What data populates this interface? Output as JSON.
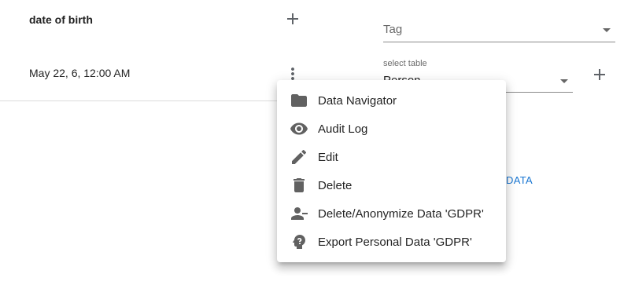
{
  "row1": {
    "field_name": "date of birth",
    "add_icon": "plus-icon"
  },
  "row2": {
    "field_value": "May 22, 6, 12:00 AM",
    "more_icon": "more-vert-icon"
  },
  "tag_select": {
    "value": "Tag"
  },
  "table_select": {
    "label": "select table",
    "value": "Person",
    "add_icon": "plus-icon"
  },
  "background_link": "DATA",
  "colors": {
    "accent": "#1976d2",
    "icon": "#616161"
  },
  "menu": {
    "items": [
      {
        "label": "Data Navigator",
        "icon": "folder-icon"
      },
      {
        "label": "Audit Log",
        "icon": "eye-icon"
      },
      {
        "label": "Edit",
        "icon": "pencil-icon"
      },
      {
        "label": "Delete",
        "icon": "trash-icon"
      },
      {
        "label": "Delete/Anonymize Data 'GDPR'",
        "icon": "person-remove-icon"
      },
      {
        "label": "Export Personal Data 'GDPR'",
        "icon": "head-question-icon"
      }
    ]
  }
}
